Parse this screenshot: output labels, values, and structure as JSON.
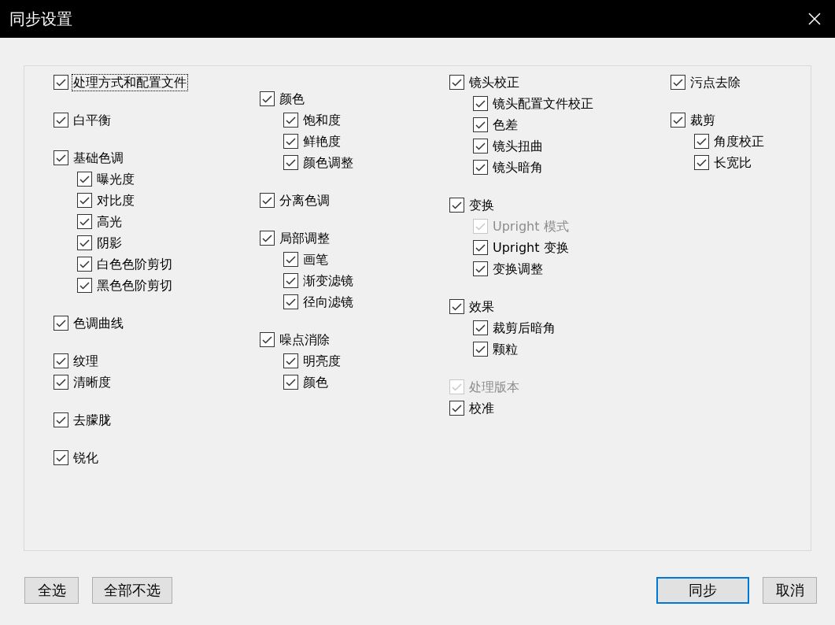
{
  "window": {
    "title": "同步设置"
  },
  "columns": [
    {
      "groups": [
        [
          {
            "label": "处理方式和配置文件",
            "checked": true,
            "disabled": false,
            "focused": true
          }
        ],
        [
          {
            "label": "白平衡",
            "checked": true,
            "disabled": false,
            "focused": false
          }
        ],
        [
          {
            "label": "基础色调",
            "checked": true,
            "disabled": false,
            "focused": false,
            "children": [
              {
                "label": "曝光度",
                "checked": true,
                "disabled": false,
                "focused": false
              },
              {
                "label": "对比度",
                "checked": true,
                "disabled": false,
                "focused": false
              },
              {
                "label": "高光",
                "checked": true,
                "disabled": false,
                "focused": false
              },
              {
                "label": "阴影",
                "checked": true,
                "disabled": false,
                "focused": false
              },
              {
                "label": "白色色阶剪切",
                "checked": true,
                "disabled": false,
                "focused": false
              },
              {
                "label": "黑色色阶剪切",
                "checked": true,
                "disabled": false,
                "focused": false
              }
            ]
          }
        ],
        [
          {
            "label": "色调曲线",
            "checked": true,
            "disabled": false,
            "focused": false
          }
        ],
        [
          {
            "label": "纹理",
            "checked": true,
            "disabled": false,
            "focused": false
          },
          {
            "label": "清晰度",
            "checked": true,
            "disabled": false,
            "focused": false
          }
        ],
        [
          {
            "label": "去朦胧",
            "checked": true,
            "disabled": false,
            "focused": false
          }
        ],
        [
          {
            "label": "锐化",
            "checked": true,
            "disabled": false,
            "focused": false
          }
        ]
      ]
    },
    {
      "groups": [
        [
          {
            "label": "颜色",
            "checked": true,
            "disabled": false,
            "focused": false,
            "children": [
              {
                "label": "饱和度",
                "checked": true,
                "disabled": false,
                "focused": false
              },
              {
                "label": "鲜艳度",
                "checked": true,
                "disabled": false,
                "focused": false
              },
              {
                "label": "颜色调整",
                "checked": true,
                "disabled": false,
                "focused": false
              }
            ]
          }
        ],
        [
          {
            "label": "分离色调",
            "checked": true,
            "disabled": false,
            "focused": false
          }
        ],
        [
          {
            "label": "局部调整",
            "checked": true,
            "disabled": false,
            "focused": false,
            "children": [
              {
                "label": "画笔",
                "checked": true,
                "disabled": false,
                "focused": false
              },
              {
                "label": "渐变滤镜",
                "checked": true,
                "disabled": false,
                "focused": false
              },
              {
                "label": "径向滤镜",
                "checked": true,
                "disabled": false,
                "focused": false
              }
            ]
          }
        ],
        [
          {
            "label": "噪点消除",
            "checked": true,
            "disabled": false,
            "focused": false,
            "children": [
              {
                "label": "明亮度",
                "checked": true,
                "disabled": false,
                "focused": false
              },
              {
                "label": "颜色",
                "checked": true,
                "disabled": false,
                "focused": false
              }
            ]
          }
        ]
      ]
    },
    {
      "groups": [
        [
          {
            "label": "镜头校正",
            "checked": true,
            "disabled": false,
            "focused": false,
            "children": [
              {
                "label": "镜头配置文件校正",
                "checked": true,
                "disabled": false,
                "focused": false
              },
              {
                "label": "色差",
                "checked": true,
                "disabled": false,
                "focused": false
              },
              {
                "label": "镜头扭曲",
                "checked": true,
                "disabled": false,
                "focused": false
              },
              {
                "label": "镜头暗角",
                "checked": true,
                "disabled": false,
                "focused": false
              }
            ]
          }
        ],
        [
          {
            "label": "变换",
            "checked": true,
            "disabled": false,
            "focused": false,
            "children": [
              {
                "label": "Upright 模式",
                "checked": true,
                "disabled": true,
                "focused": false
              },
              {
                "label": "Upright 变换",
                "checked": true,
                "disabled": false,
                "focused": false
              },
              {
                "label": "变换调整",
                "checked": true,
                "disabled": false,
                "focused": false
              }
            ]
          }
        ],
        [
          {
            "label": "效果",
            "checked": true,
            "disabled": false,
            "focused": false,
            "children": [
              {
                "label": "裁剪后暗角",
                "checked": true,
                "disabled": false,
                "focused": false
              },
              {
                "label": "颗粒",
                "checked": true,
                "disabled": false,
                "focused": false
              }
            ]
          }
        ],
        [
          {
            "label": "处理版本",
            "checked": true,
            "disabled": true,
            "focused": false
          },
          {
            "label": "校准",
            "checked": true,
            "disabled": false,
            "focused": false
          }
        ]
      ]
    },
    {
      "groups": [
        [
          {
            "label": "污点去除",
            "checked": true,
            "disabled": false,
            "focused": false
          }
        ],
        [
          {
            "label": "裁剪",
            "checked": true,
            "disabled": false,
            "focused": false,
            "children": [
              {
                "label": "角度校正",
                "checked": true,
                "disabled": false,
                "focused": false
              },
              {
                "label": "长宽比",
                "checked": true,
                "disabled": false,
                "focused": false
              }
            ]
          }
        ]
      ]
    }
  ],
  "left_buttons": [
    {
      "label": "全选",
      "default": false
    },
    {
      "label": "全部不选",
      "default": false
    }
  ],
  "right_buttons": [
    {
      "label": "同步",
      "default": true
    },
    {
      "label": "取消",
      "default": false
    }
  ]
}
